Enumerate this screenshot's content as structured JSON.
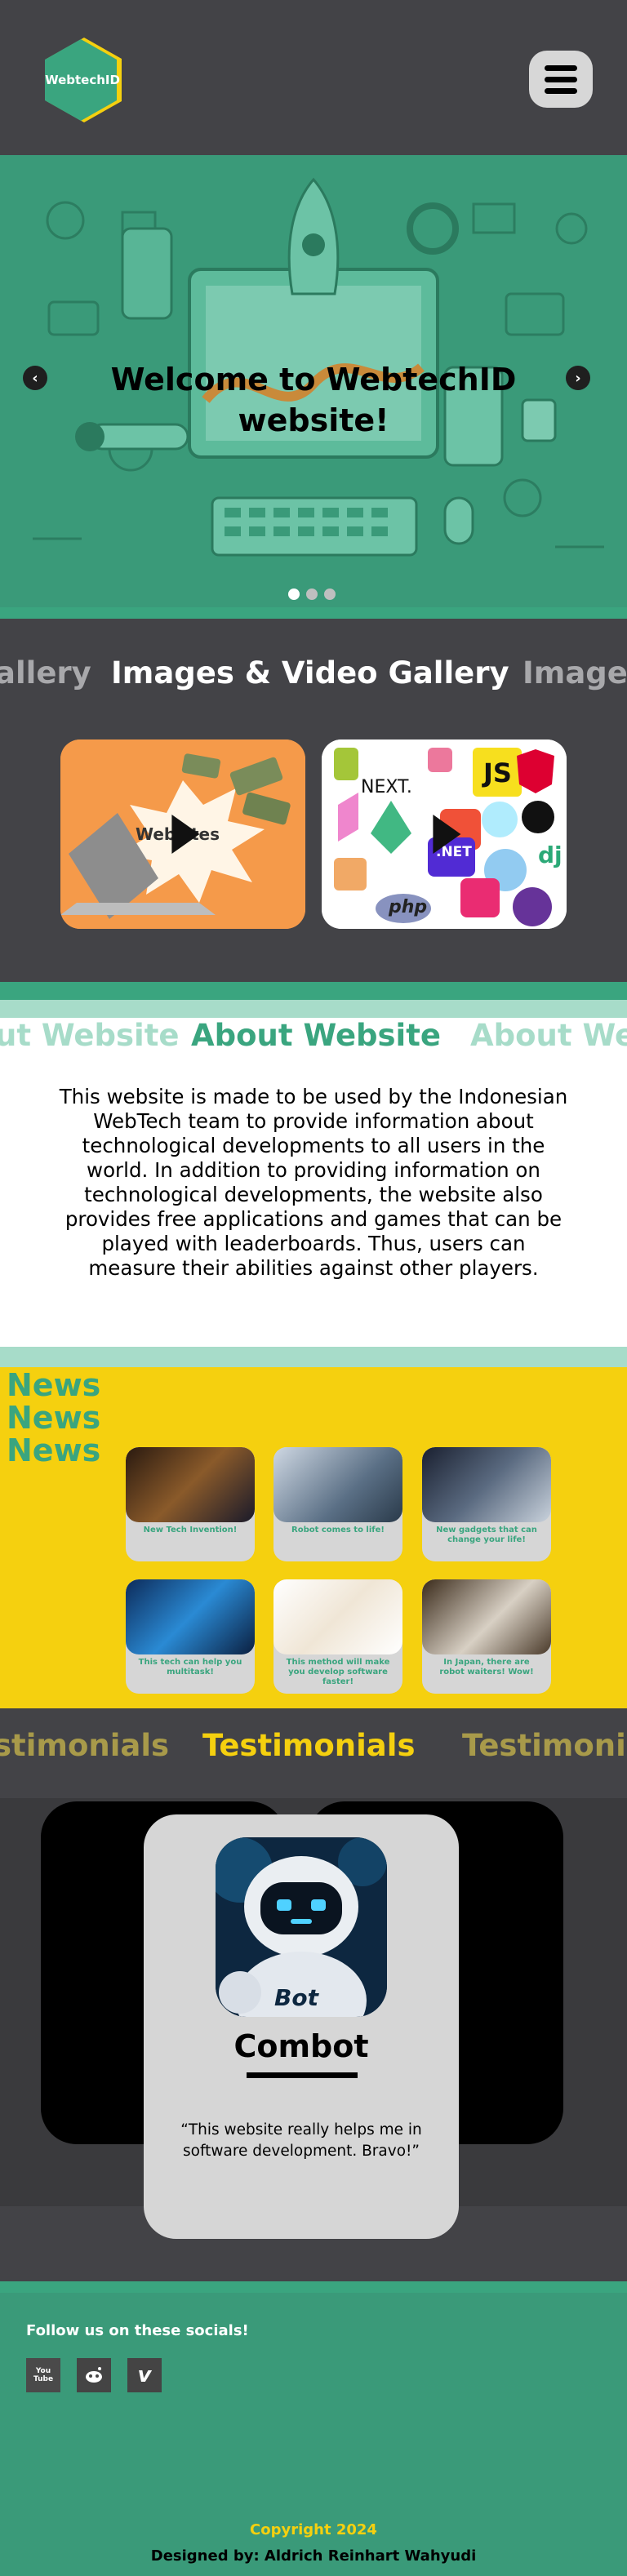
{
  "header": {
    "logo_text": "WebtechID",
    "menu_icon": "hamburger-menu-icon"
  },
  "hero": {
    "title": "Welcome to WebtechID website!",
    "prev_icon": "chevron-left-icon",
    "next_icon": "chevron-right-icon",
    "slide_count": 3,
    "active_slide": 1
  },
  "gallery": {
    "marquee": [
      "allery",
      "Images & Video Gallery",
      "Image"
    ],
    "cards": [
      {
        "label": "Websites",
        "icon": "play-icon"
      },
      {
        "labels": [
          "NEXT.",
          "JS",
          ".NET",
          "dj",
          "php"
        ],
        "icon": "play-icon"
      }
    ]
  },
  "about": {
    "marquee": [
      "ut Website",
      "About Website",
      "About We"
    ],
    "text": "This website is made to be used by the Indonesian WebTech team to provide information about technological developments to all users in the world. In addition to providing information on technological developments, the website also provides free applications and games that can be played with leaderboards. Thus, users can measure their abilities against other players."
  },
  "news": {
    "titles": [
      "News",
      "News",
      "News"
    ],
    "items": [
      {
        "caption": "New Tech Invention!"
      },
      {
        "caption": "Robot comes to life!"
      },
      {
        "caption": "New gadgets that can change your life!"
      },
      {
        "caption": "This tech can help you multitask!"
      },
      {
        "caption": "This method will make you develop software faster!"
      },
      {
        "caption": "In Japan, there are robot waiters! Wow!"
      }
    ]
  },
  "testimonials": {
    "marquee": [
      "stimonials",
      "Testimonials",
      "Testimoni"
    ],
    "name": "Combot",
    "avatar_text": "Bot",
    "quote": "“This website really helps me in software development. Bravo!”"
  },
  "footer": {
    "follow": "Follow us on these socials!",
    "socials": [
      "youtube-icon",
      "reddit-icon",
      "vimeo-icon"
    ],
    "youtube_label": "You Tube",
    "copyright": "Copyright 2024",
    "designed_by": "Designed by: Aldrich Reinhart Wahyudi"
  },
  "colors": {
    "green": "#3aa57f",
    "light_green": "#a7dcc9",
    "yellow": "#f5d00f",
    "dark": "#434347"
  }
}
